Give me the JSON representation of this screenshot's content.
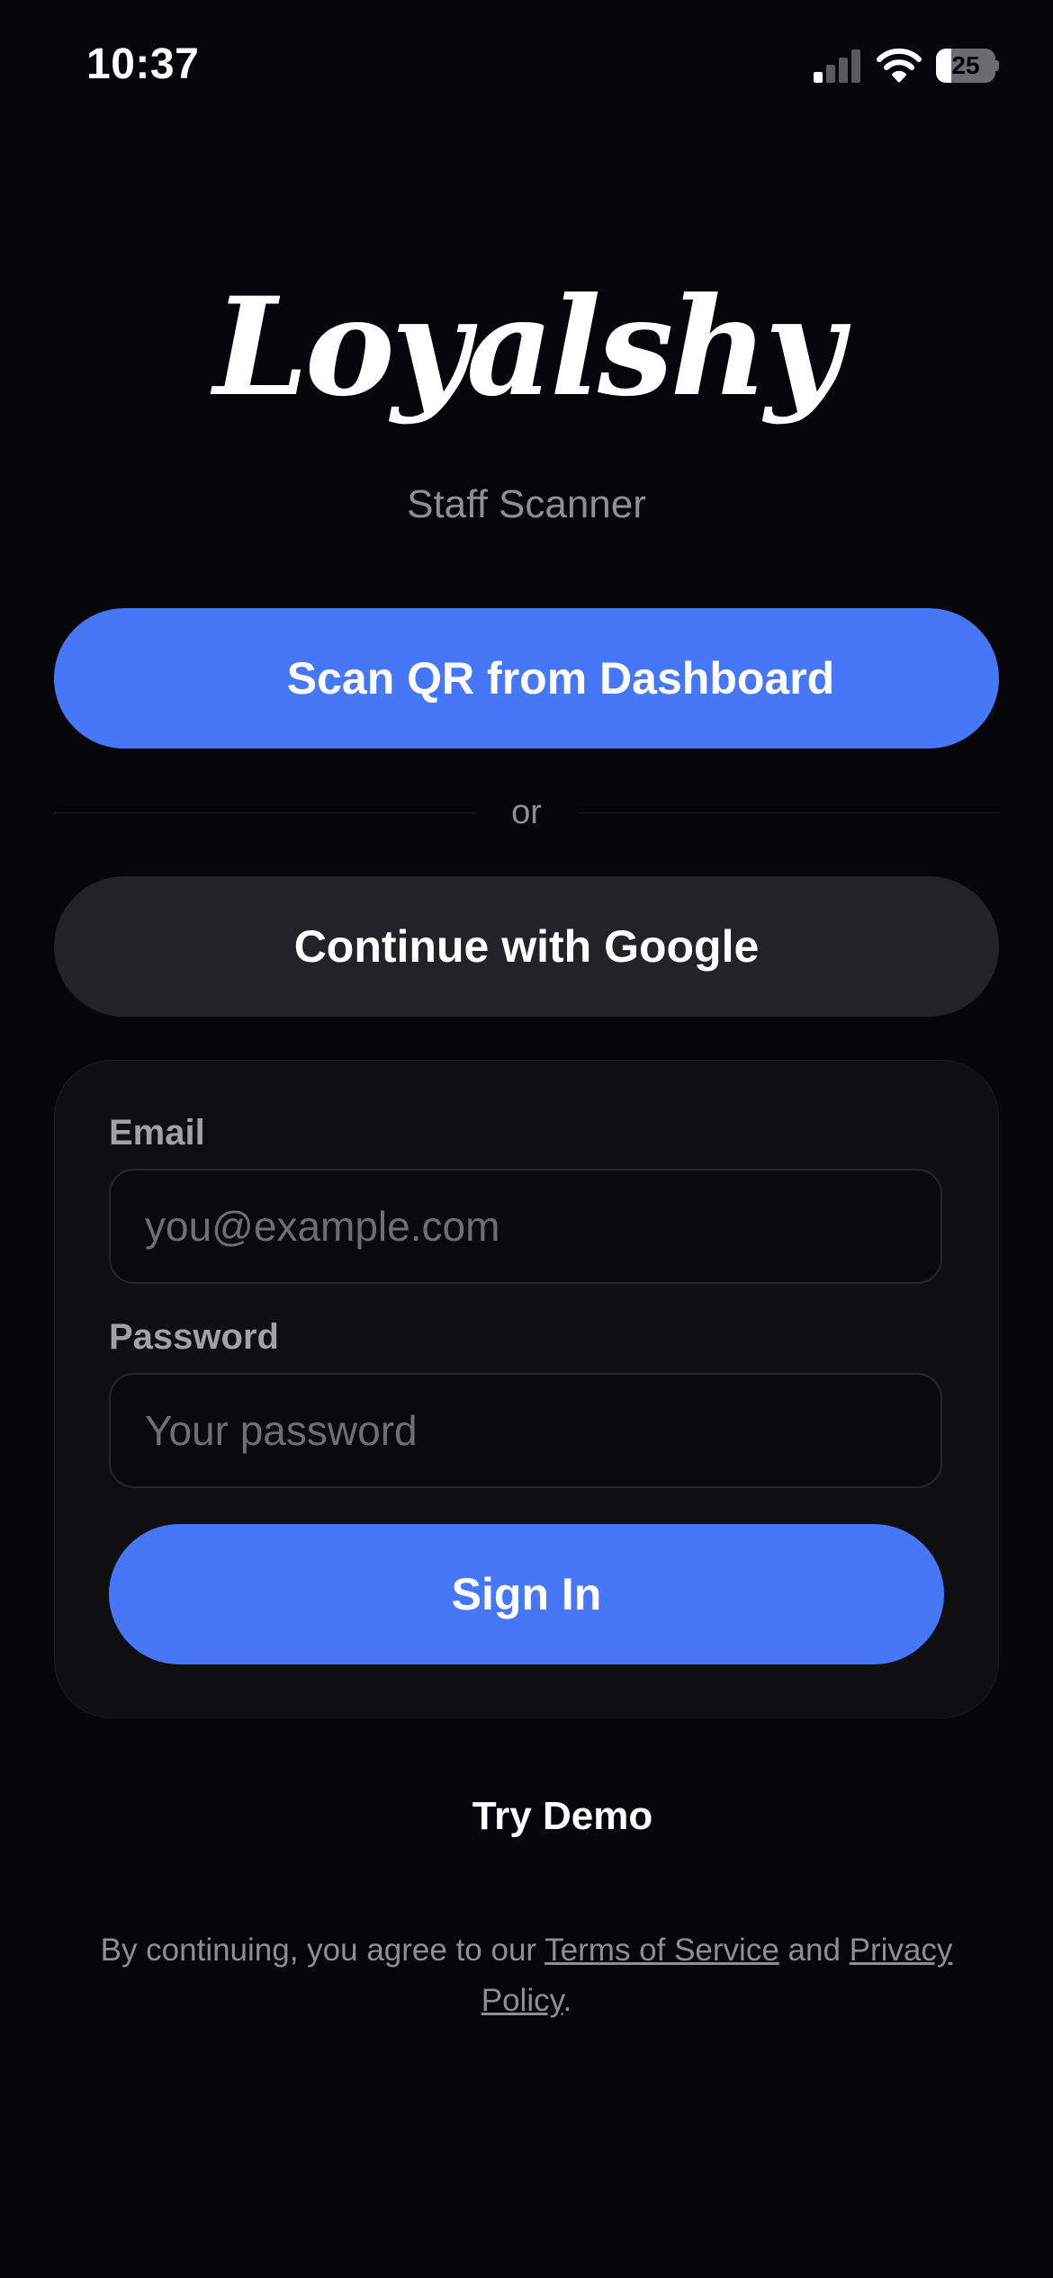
{
  "status_bar": {
    "time": "10:37",
    "battery_level": "25",
    "battery_percent": 25,
    "signal_bars_active": 1,
    "signal_bars_total": 4,
    "icons": [
      "signal-icon",
      "wifi-icon",
      "battery-icon"
    ]
  },
  "brand": {
    "logo": "Loyalshy",
    "subtitle": "Staff Scanner"
  },
  "actions": {
    "scan_label": "Scan QR from Dashboard",
    "divider_label": "or",
    "google_label": "Continue with Google"
  },
  "form": {
    "email_label": "Email",
    "email_value": "",
    "email_placeholder": "you@example.com",
    "password_label": "Password",
    "password_value": "",
    "password_placeholder": "Your password",
    "signin_label": "Sign In"
  },
  "footer": {
    "demo_label": "Try Demo",
    "legal_prefix": "By continuing, you agree to our ",
    "terms_label": "Terms of Service",
    "legal_and": " and ",
    "privacy_label": "Privacy Policy",
    "legal_suffix": "."
  },
  "colors": {
    "background": "#060608",
    "accent": "#4677f6",
    "secondary_button": "#232326",
    "card": "#0f0f11",
    "muted_text": "#8e8e93"
  }
}
